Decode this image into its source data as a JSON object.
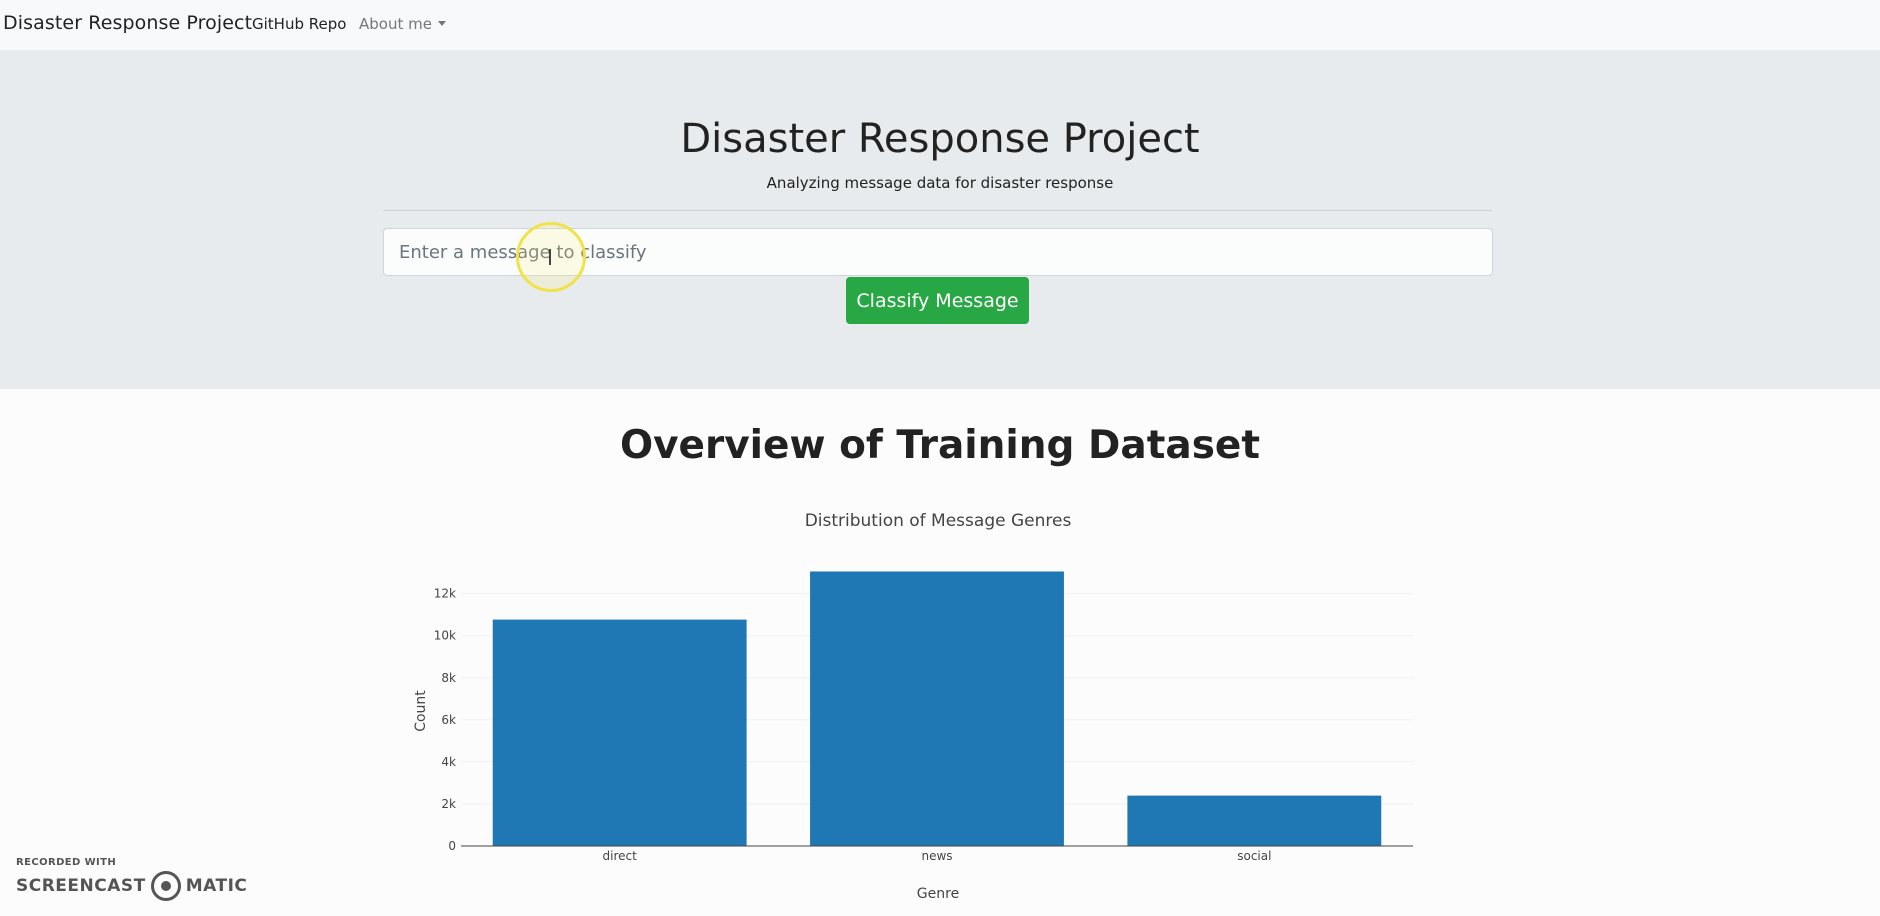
{
  "navbar": {
    "brand": "Disaster Response Project",
    "links": [
      {
        "label": "GitHub Repo"
      },
      {
        "label": "About me"
      }
    ]
  },
  "hero": {
    "title": "Disaster Response Project",
    "subtitle": "Analyzing message data for disaster response",
    "input_placeholder": "Enter a message to classify",
    "button_label": "Classify Message"
  },
  "overview": {
    "title": "Overview of Training Dataset"
  },
  "colors": {
    "bar": "#1f77b4",
    "button": "#28a745"
  },
  "chart_data": {
    "type": "bar",
    "title": "Distribution of Message Genres",
    "xlabel": "Genre",
    "ylabel": "Count",
    "categories": [
      "direct",
      "news",
      "social"
    ],
    "values": [
      10766,
      13054,
      2396
    ],
    "ylim": [
      0,
      13600
    ],
    "yticks": [
      0,
      2000,
      4000,
      6000,
      8000,
      10000,
      12000
    ],
    "ytick_labels": [
      "0",
      "2k",
      "4k",
      "6k",
      "8k",
      "10k",
      "12k"
    ],
    "grid": true
  },
  "watermark": {
    "line1": "RECORDED WITH",
    "left": "SCREENCAST",
    "right": "MATIC"
  }
}
